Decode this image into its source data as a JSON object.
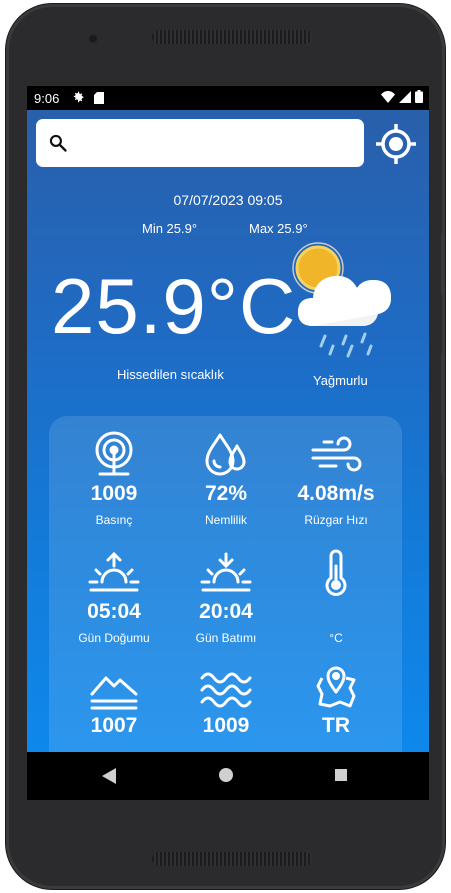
{
  "status": {
    "time": "9:06"
  },
  "search": {
    "value": "",
    "placeholder": ""
  },
  "weather": {
    "datetime": "07/07/2023 09:05",
    "min": "Min 25.9°",
    "max": "Max 25.9°",
    "temperature": "25.9°C",
    "feels_like_label": "Hissedilen sıcaklık",
    "condition": "Yağmurlu",
    "condition_icon": "sun-cloud-rain-icon"
  },
  "details": [
    {
      "icon": "pressure-gauge-icon",
      "value": "1009",
      "label": "Basınç"
    },
    {
      "icon": "humidity-drops-icon",
      "value": "72%",
      "label": "Nemlilik"
    },
    {
      "icon": "wind-icon",
      "value": "4.08m/s",
      "label": "Rüzgar Hızı"
    },
    {
      "icon": "sunrise-icon",
      "value": "05:04",
      "label": "Gün Doğumu"
    },
    {
      "icon": "sunset-icon",
      "value": "20:04",
      "label": "Gün Batımı"
    },
    {
      "icon": "thermometer-icon",
      "value": "",
      "label": "°C"
    },
    {
      "icon": "mountains-icon",
      "value": "1007",
      "label": ""
    },
    {
      "icon": "waves-icon",
      "value": "1009",
      "label": ""
    },
    {
      "icon": "map-location-icon",
      "value": "TR",
      "label": ""
    }
  ]
}
